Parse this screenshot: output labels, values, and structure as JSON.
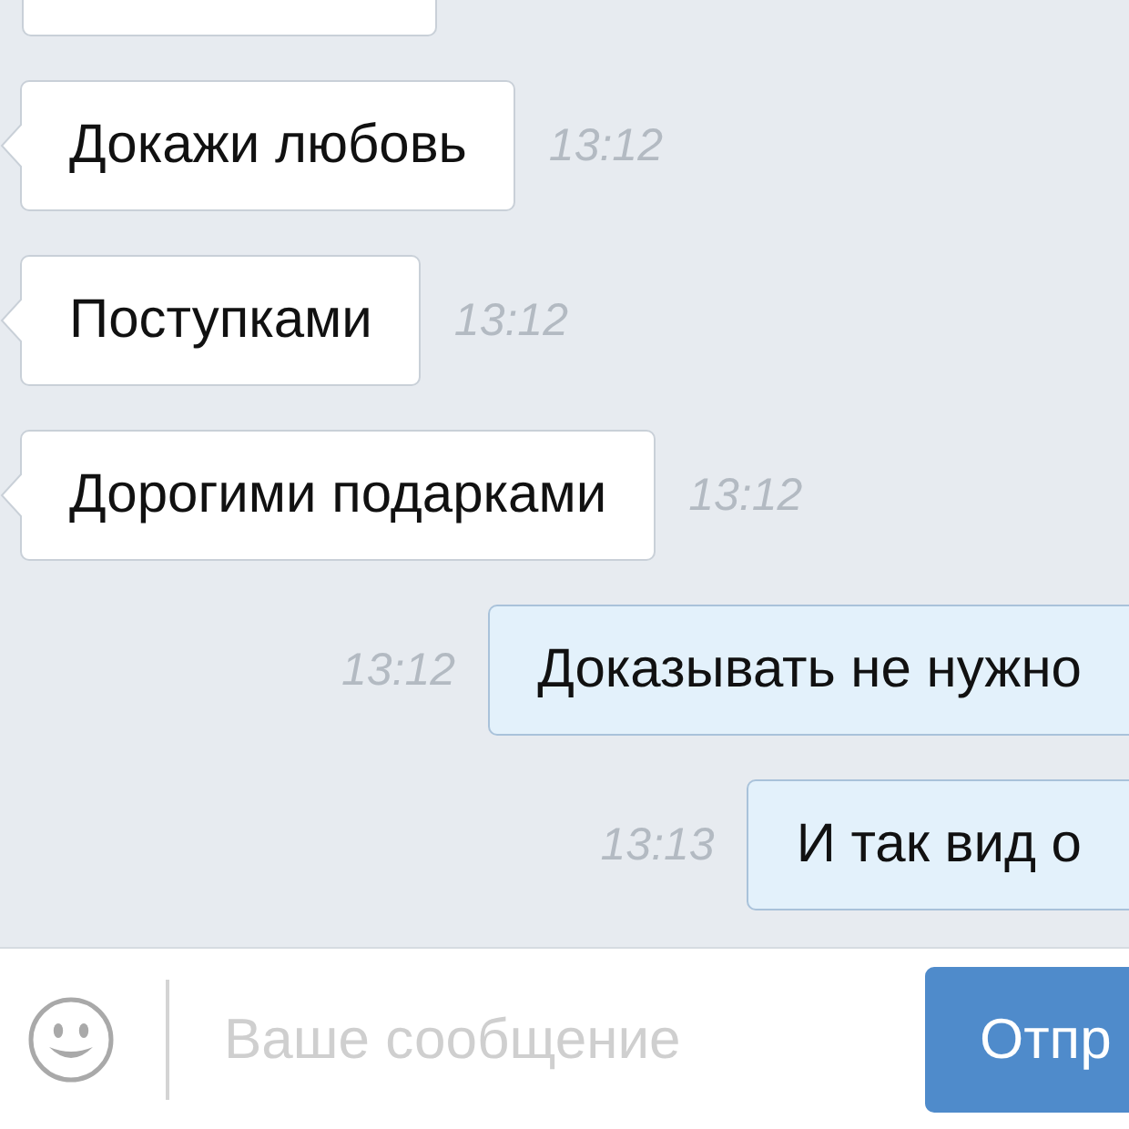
{
  "messages": [
    {
      "kind": "partial"
    },
    {
      "kind": "incoming",
      "text": "Докажи любовь",
      "time": "13:12"
    },
    {
      "kind": "incoming",
      "text": "Поступками",
      "time": "13:12"
    },
    {
      "kind": "incoming",
      "text": "Дорогими подарками",
      "time": "13:12"
    },
    {
      "kind": "outgoing",
      "text": "Доказывать не нужно",
      "time": "13:12"
    },
    {
      "kind": "outgoing",
      "text": "И так вид о",
      "time": "13:13"
    }
  ],
  "composer": {
    "placeholder": "Ваше сообщение",
    "send_label": "Отпр"
  }
}
